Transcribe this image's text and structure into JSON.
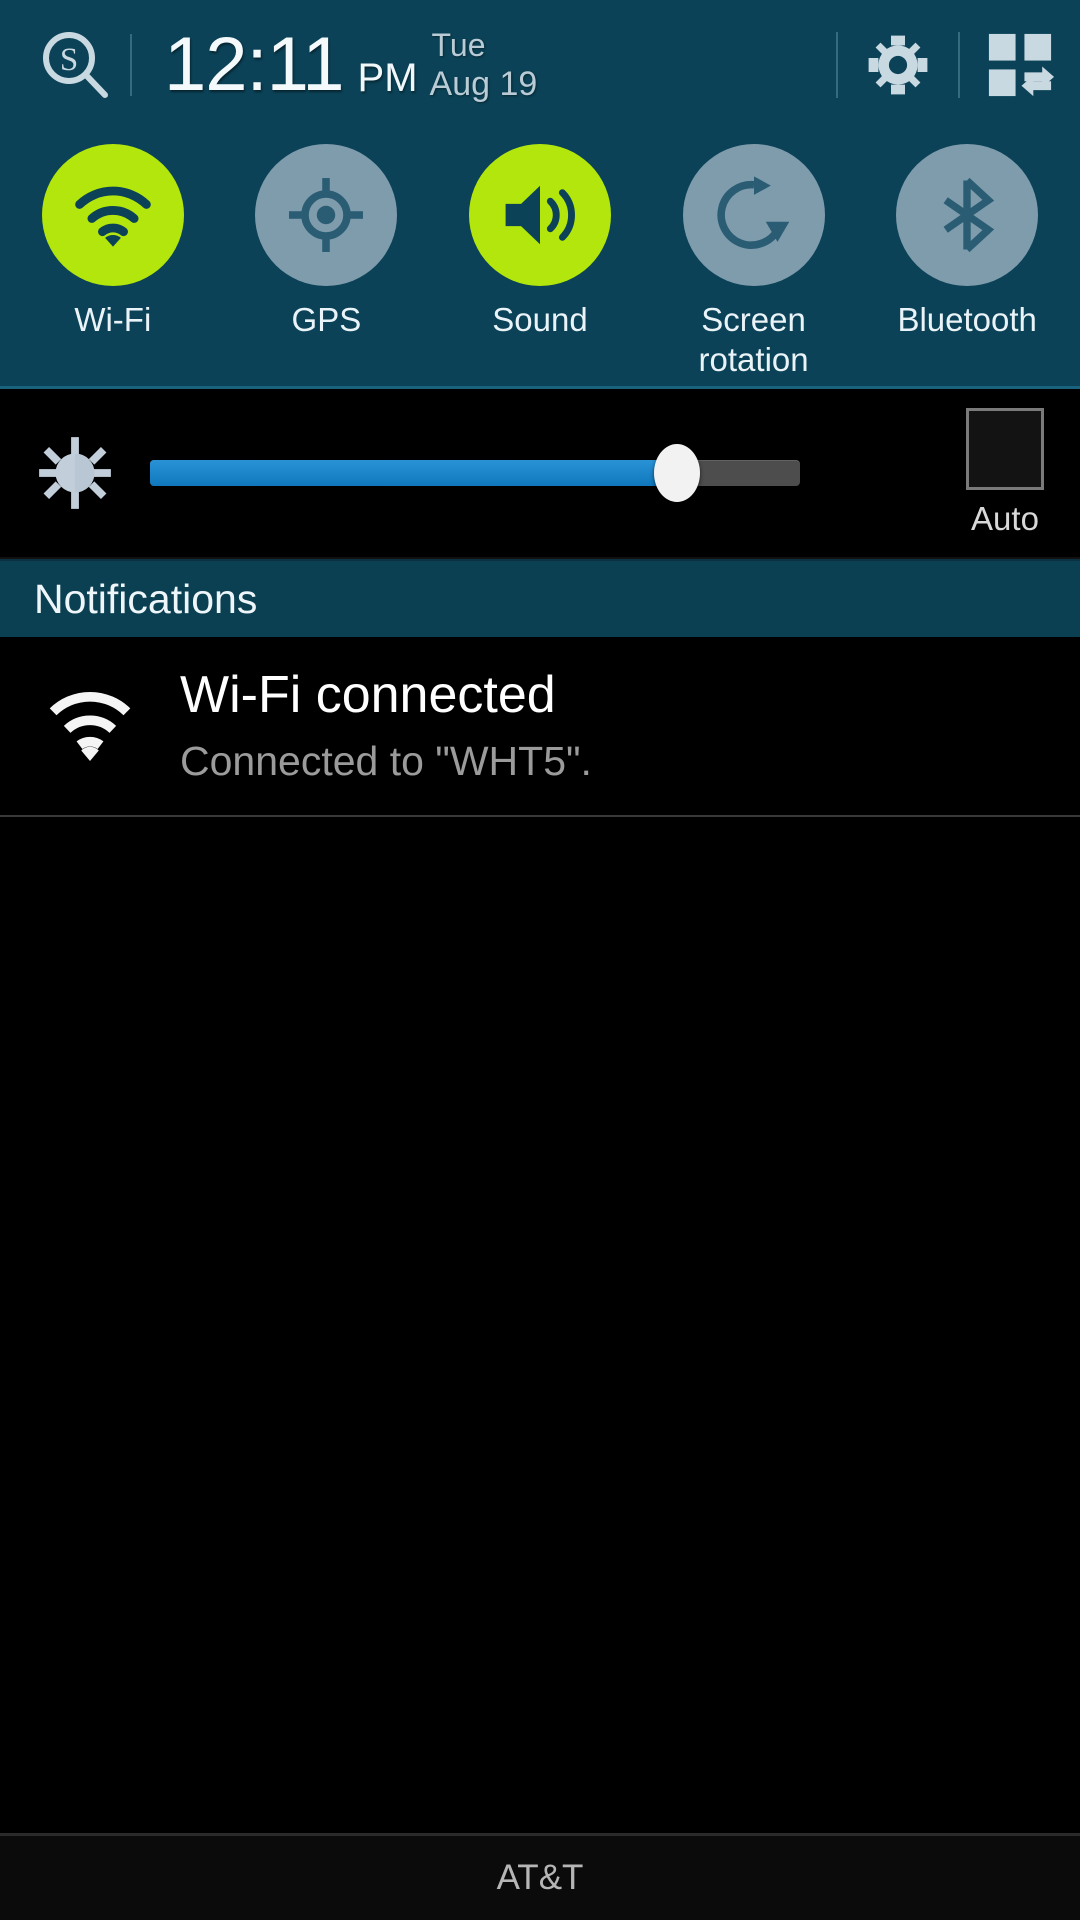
{
  "status_bar": {
    "sfinder_icon": "s-finder-search-icon",
    "time": "12:11",
    "ampm": "PM",
    "day_of_week": "Tue",
    "month_day": "Aug 19",
    "settings_icon": "gear-icon",
    "quick_settings_icon": "quick-settings-grid-icon"
  },
  "quick_toggles": [
    {
      "label": "Wi-Fi",
      "icon": "wifi-icon",
      "state": "on"
    },
    {
      "label": "GPS",
      "icon": "gps-crosshair-icon",
      "state": "off"
    },
    {
      "label": "Sound",
      "icon": "sound-speaker-icon",
      "state": "on"
    },
    {
      "label": "Screen rotation",
      "icon": "screen-rotation-icon",
      "state": "off"
    },
    {
      "label": "Bluetooth",
      "icon": "bluetooth-icon",
      "state": "off"
    }
  ],
  "brightness": {
    "icon": "brightness-gear-icon",
    "value_percent": 81,
    "auto_label": "Auto",
    "auto_checked": false
  },
  "notifications": {
    "header": "Notifications",
    "items": [
      {
        "icon": "wifi-icon",
        "title": "Wi-Fi connected",
        "subtitle": "Connected to \"WHT5\"."
      }
    ]
  },
  "footer": {
    "carrier": "AT&T"
  },
  "colors": {
    "panel_teal": "#0b4257",
    "notif_header_teal": "#0b3f52",
    "toggle_on_green": "#b2e60c",
    "toggle_off_gray": "#7f9cac",
    "slider_blue": "#1f8ad0",
    "background_black": "#000000"
  }
}
